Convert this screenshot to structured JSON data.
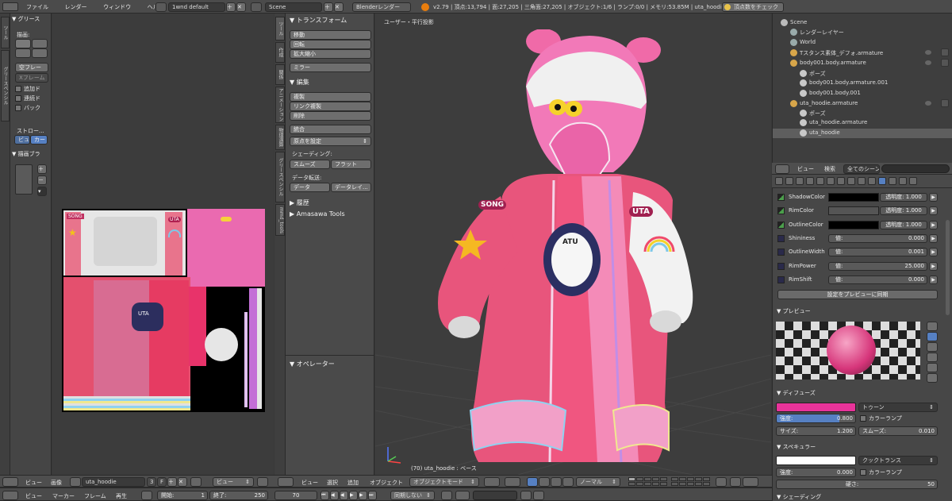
{
  "topbar": {
    "menus": [
      "ファイル",
      "レンダー",
      "ウィンドウ",
      "ヘルプ"
    ],
    "layout": "1wnd default",
    "scene": "Scene",
    "engine": "Blenderレンダー",
    "stats": "v2.79 | 頂点:13,794 | 面:27,205 | 三角面:27,205 | オブジェクト:1/6 | ランプ:0/0 | メモリ:53.85M | uta_hoodie",
    "check_vertices": "頂点数をチェック"
  },
  "image_editor_tools": {
    "grease": "グリース",
    "draw": "描画:",
    "items": [
      "空フレー",
      "Xフレーム"
    ],
    "checks": [
      "追加ド",
      "連続ド",
      "バック"
    ],
    "stroke": "ストロー...",
    "stroke_opts": [
      "ビュ",
      "カー"
    ],
    "draw_brush": "描画ブラ",
    "side_tabs": [
      "ツール",
      "グリースペンシル"
    ]
  },
  "uv_texture": {
    "labels": [
      "SONG",
      "UTA"
    ],
    "center_badge": "UTA"
  },
  "tool_shelf": {
    "transform_header": "トランスフォーム",
    "transform": [
      "移動",
      "回転",
      "拡大縮小"
    ],
    "mirror": "ミラー",
    "edit_header": "編集",
    "edit": [
      "複製",
      "リンク複製",
      "削除"
    ],
    "join": "統合",
    "origin": "原点を設定",
    "shading": "シェーディング:",
    "smooth": "スムーズ",
    "flat": "フラット",
    "data_transfer": "データ転送:",
    "data": "データ",
    "data_layout": "データレイ...",
    "history": "履歴",
    "amasawa": "Amasawa Tools",
    "operator": "オペレーター",
    "side_tabs": [
      "ツール",
      "作成",
      "関係",
      "アニメーション",
      "物理演算",
      "グリースペンシル",
      "mmd_tools"
    ]
  },
  "viewport": {
    "title": "ユーザー・平行投影",
    "frame_info": "(70) uta_hoodie : ベース",
    "hoodie_badges": [
      "SONG",
      "UTA",
      "ATU"
    ]
  },
  "outliner": {
    "items": [
      {
        "label": "Scene",
        "indent": 0
      },
      {
        "label": "レンダーレイヤー",
        "indent": 1
      },
      {
        "label": "World",
        "indent": 1
      },
      {
        "label": "Tスタンス素体_デフォ.armature",
        "indent": 1
      },
      {
        "label": "body001.body.armature",
        "indent": 1
      },
      {
        "label": "ポーズ",
        "indent": 2
      },
      {
        "label": "body001.body.armature.001",
        "indent": 2
      },
      {
        "label": "body001.body.001",
        "indent": 2
      },
      {
        "label": "uta_hoodie.armature",
        "indent": 1
      },
      {
        "label": "ポーズ",
        "indent": 2
      },
      {
        "label": "uta_hoodie.armature",
        "indent": 2
      },
      {
        "label": "uta_hoodie",
        "indent": 2
      }
    ],
    "footer_view": "ビュー",
    "footer_search": "検索",
    "footer_scene": "全てのシーン"
  },
  "properties": {
    "rows": [
      {
        "name": "ShadowColor",
        "value": "透明度: 1.000"
      },
      {
        "name": "RimColor",
        "value": "透明度: 1.000"
      },
      {
        "name": "OutlineColor",
        "value": "透明度: 1.000"
      },
      {
        "name": "Shininess",
        "value": "値:",
        "num": "0.000"
      },
      {
        "name": "OutlineWidth",
        "value": "値:",
        "num": "0.001"
      },
      {
        "name": "RimPower",
        "value": "値:",
        "num": "25.000"
      },
      {
        "name": "RimShift",
        "value": "値:",
        "num": "0.000"
      }
    ],
    "sync_preview": "設定をプレビューに同期",
    "preview": "プレビュー",
    "diffuse": "ディフューズ",
    "diffuse_shader": "トゥーン",
    "intensity_label": "強度:",
    "intensity_value": "0.800",
    "ramp": "カラーランプ",
    "size_label": "サイズ:",
    "size_value": "1.200",
    "smooth_label": "スムーズ:",
    "smooth_value": "0.010",
    "specular": "スペキュラー",
    "specular_shader": "クックトランス",
    "spec_intensity_value": "0.000",
    "hardness_label": "硬さ:",
    "hardness_value": "50",
    "shading": "シェーディング",
    "diffuse_color": "#e8339a",
    "spec_color": "#ffffff"
  },
  "image_footer": {
    "view": "ビュー",
    "image": "画像",
    "image_name": "uta_hoodie",
    "users": "3",
    "fake": "F",
    "view2": "ビュー"
  },
  "view3d_footer": {
    "view": "ビュー",
    "select": "選択",
    "add": "追加",
    "object": "オブジェクト",
    "mode": "オブジェクトモード",
    "orientation": "ノーマル"
  },
  "timeline": {
    "view": "ビュー",
    "marker": "マーカー",
    "frame": "フレーム",
    "playback": "再生",
    "start_label": "開始:",
    "start_value": "1",
    "end_label": "終了:",
    "end_value": "250",
    "current": "70",
    "sync": "同期しない"
  }
}
